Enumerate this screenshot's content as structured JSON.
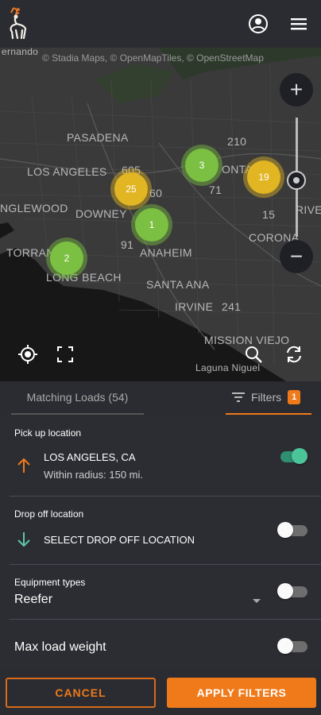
{
  "map": {
    "attribution": "© Stadia Maps, © OpenMapTiles, © OpenStreetMap",
    "places": [
      "PASADENA",
      "LOS ANGELES",
      "NGLEWOOD",
      "DOWNEY",
      "TORRANCE",
      "LONG BEACH",
      "ANAHEIM",
      "SANTA ANA",
      "IRVINE",
      "MISSION VIEJO",
      "Laguna Niguel",
      "ONTARIO",
      "CORONA",
      "RIVE",
      "ernando"
    ],
    "road_numbers": [
      "210",
      "605",
      "60",
      "71",
      "15",
      "91",
      "241"
    ],
    "clusters": [
      {
        "count": "3",
        "color": "green"
      },
      {
        "count": "25",
        "color": "yellow"
      },
      {
        "count": "1",
        "color": "green"
      },
      {
        "count": "19",
        "color": "yellow"
      },
      {
        "count": "2",
        "color": "green"
      }
    ],
    "zoom_in_label": "+",
    "zoom_out_label": "−"
  },
  "tabs": {
    "loads_label": "Matching Loads (54)",
    "filters_label": "Filters",
    "filters_count": "1"
  },
  "pickup": {
    "label": "Pick up location",
    "city": "LOS ANGELES, CA",
    "radius": "Within radius: 150 mi.",
    "enabled": true
  },
  "dropoff": {
    "label": "Drop off location",
    "placeholder": "SELECT DROP OFF LOCATION",
    "enabled": false
  },
  "equipment": {
    "label": "Equipment types",
    "value": "Reefer",
    "enabled": false
  },
  "max_weight": {
    "label": "Max load weight",
    "enabled": false
  },
  "actions": {
    "cancel": "CANCEL",
    "apply": "APPLY FILTERS"
  },
  "colors": {
    "accent": "#f07a1a",
    "toggle_on": "#4cc49a",
    "cluster_green": "#7bc043",
    "cluster_yellow": "#e2b523"
  }
}
